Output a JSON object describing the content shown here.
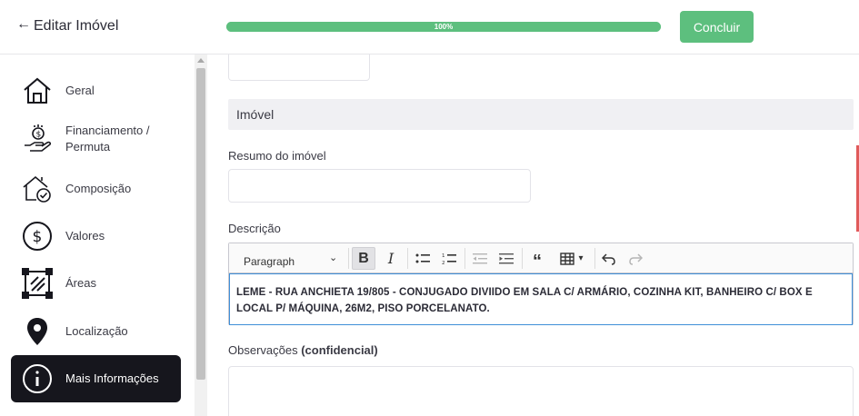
{
  "header": {
    "back_icon": "arrow-left-icon",
    "title": "Editar Imóvel",
    "progress_percent": 100,
    "progress_label": "100%",
    "done_label": "Concluir",
    "accent_color": "#5dbf7e"
  },
  "sidebar": {
    "items": [
      {
        "label": "Geral",
        "icon": "house-icon",
        "active": false
      },
      {
        "label": "Financiamento / Permuta",
        "icon": "money-hand-icon",
        "active": false
      },
      {
        "label": "Composição",
        "icon": "house-check-icon",
        "active": false
      },
      {
        "label": "Valores",
        "icon": "dollar-circle-icon",
        "active": false
      },
      {
        "label": "Áreas",
        "icon": "area-square-icon",
        "active": false
      },
      {
        "label": "Localização",
        "icon": "map-pin-icon",
        "active": false
      },
      {
        "label": "Mais Informações",
        "icon": "info-circle-icon",
        "active": true
      }
    ]
  },
  "main": {
    "section_title": "Imóvel",
    "resumo": {
      "label": "Resumo do imóvel",
      "value": ""
    },
    "descricao": {
      "label": "Descrição",
      "toolbar": {
        "paragraph": "Paragraph"
      },
      "text": "LEME - RUA ANCHIETA 19/805 - CONJUGADO DIVIIDO EM SALA C/ ARMÁRIO, COZINHA KIT, BANHEIRO C/ BOX E LOCAL P/ MÁQUINA, 26M2, PISO PORCELANATO."
    },
    "observacoes": {
      "label": "Observações",
      "label_strong": "(confidencial)",
      "value": ""
    }
  }
}
